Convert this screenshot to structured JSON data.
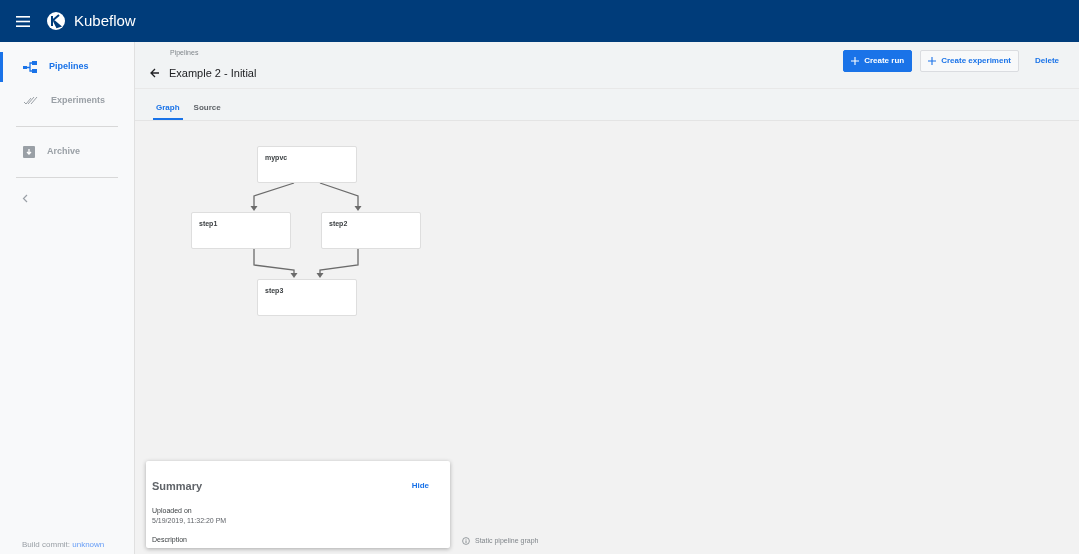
{
  "app_bar": {
    "title": "Kubeflow"
  },
  "sidebar": {
    "items": [
      {
        "label": "Pipelines",
        "selected": true
      },
      {
        "label": "Experiments",
        "selected": false
      },
      {
        "label": "Archive",
        "selected": false
      }
    ],
    "build_commit": {
      "label": "Build commit:",
      "value": "unknown"
    }
  },
  "breadcrumb": "Pipelines",
  "page_title": "Example 2 - Initial",
  "actions": [
    {
      "label": "Create run",
      "kind": "primary"
    },
    {
      "label": "Create experiment",
      "kind": "outlined"
    },
    {
      "label": "Delete",
      "kind": "text"
    }
  ],
  "tabs": [
    {
      "label": "Graph",
      "selected": true
    },
    {
      "label": "Source",
      "selected": false
    }
  ],
  "graph": {
    "nodes": [
      {
        "label": "mypvc"
      },
      {
        "label": "step1"
      },
      {
        "label": "step2"
      },
      {
        "label": "step3"
      }
    ],
    "note": "Static pipeline graph"
  },
  "summary": {
    "title": "Summary",
    "hide": "Hide",
    "uploaded_label": "Uploaded on",
    "uploaded_value": "5/19/2019, 11:32:20 PM",
    "description_label": "Description"
  }
}
